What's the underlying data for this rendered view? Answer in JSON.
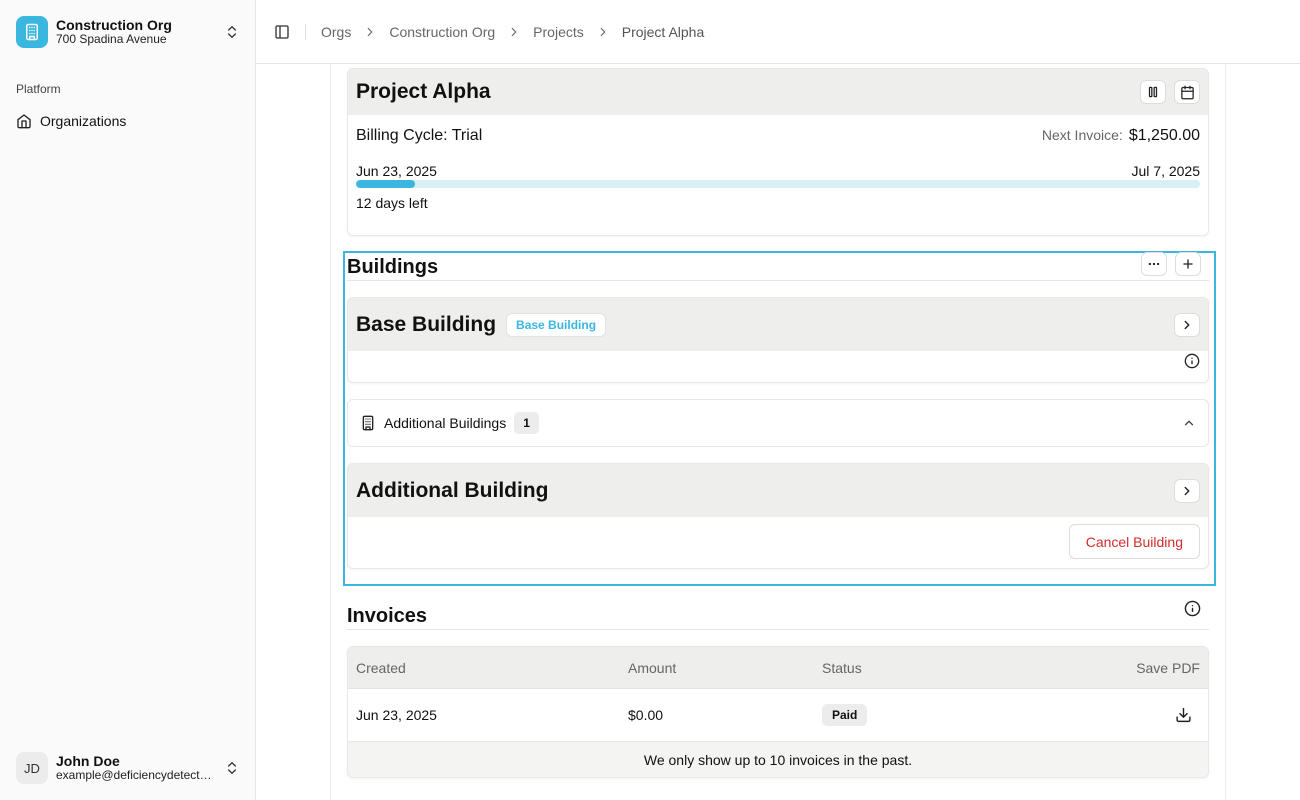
{
  "org": {
    "name": "Construction Org",
    "address": "700 Spadina Avenue"
  },
  "sidebar": {
    "group_label": "Platform",
    "items": [
      {
        "label": "Organizations",
        "icon": "home-icon"
      }
    ]
  },
  "user": {
    "initials": "JD",
    "name": "John Doe",
    "email": "example@deficiencydetect...."
  },
  "breadcrumbs": [
    "Orgs",
    "Construction Org",
    "Projects",
    "Project Alpha"
  ],
  "project": {
    "title": "Project Alpha",
    "billing_cycle": "Billing Cycle: Trial",
    "next_invoice_label": "Next Invoice:",
    "next_invoice_amount": "$1,250.00",
    "start_date": "Jun 23, 2025",
    "end_date": "Jul 7, 2025",
    "progress_percent": 7,
    "days_left": "12 days left"
  },
  "buildings": {
    "title": "Buildings",
    "base": {
      "name": "Base Building",
      "badge": "Base Building"
    },
    "additional_label": "Additional Buildings",
    "additional_count": "1",
    "additional": {
      "name": "Additional Building",
      "cancel_label": "Cancel Building"
    }
  },
  "invoices": {
    "title": "Invoices",
    "columns": [
      "Created",
      "Amount",
      "Status",
      "Save PDF"
    ],
    "rows": [
      {
        "created": "Jun 23, 2025",
        "amount": "$0.00",
        "status": "Paid"
      }
    ],
    "footer": "We only show up to 10 invoices in the past."
  },
  "colors": {
    "accent": "#3bb6de",
    "danger": "#d32b2b"
  }
}
